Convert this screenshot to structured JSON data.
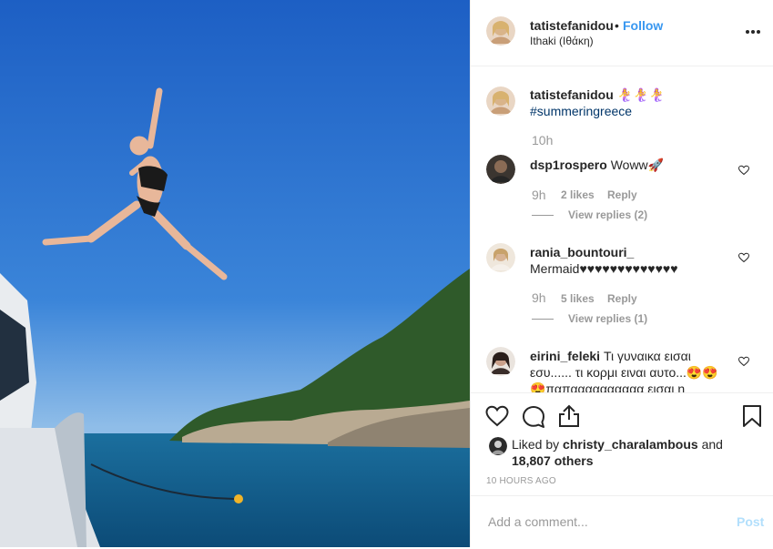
{
  "post": {
    "username": "tatistefanidou",
    "separator": "•",
    "follow_label": "Follow",
    "location": "Ithaki (Ιθάκη)"
  },
  "caption": {
    "username": "tatistefanidou",
    "emojis": "🧜‍♀️🧜‍♀️🧜‍♀️",
    "hashtag": "#summeringreece",
    "time": "10h"
  },
  "comments": [
    {
      "username": "dsp1rospero",
      "text": "Woww🚀",
      "time": "9h",
      "likes": "2 likes",
      "reply": "Reply",
      "view_replies": "View replies (2)"
    },
    {
      "username": "rania_bountouri_",
      "text": "Mermaid♥♥♥♥♥♥♥♥♥♥♥♥♥",
      "time": "9h",
      "likes": "5 likes",
      "reply": "Reply",
      "view_replies": "View replies (1)"
    },
    {
      "username": "eirini_feleki",
      "text_line1": "Τι γυναικα εισαι",
      "text_line2": "εσυ...... τι κορμι ειναι αυτο...😍😍",
      "text_line3": "😍παπαααααααααα εισαι η"
    }
  ],
  "likes": {
    "prefix": "Liked by",
    "user": "christy_charalambous",
    "joiner": "and",
    "count": "18,807 others"
  },
  "time_ago": "10 HOURS AGO",
  "add_comment": {
    "placeholder": "Add a comment...",
    "post_label": "Post"
  },
  "icons": {
    "like": "heart-icon",
    "comment": "comment-icon",
    "share": "share-icon",
    "save": "bookmark-icon",
    "more": "more-options-icon"
  },
  "colors": {
    "accent": "#3897f0",
    "hashtag": "#003569",
    "muted": "#999999",
    "post_disabled": "#b2dffc"
  }
}
